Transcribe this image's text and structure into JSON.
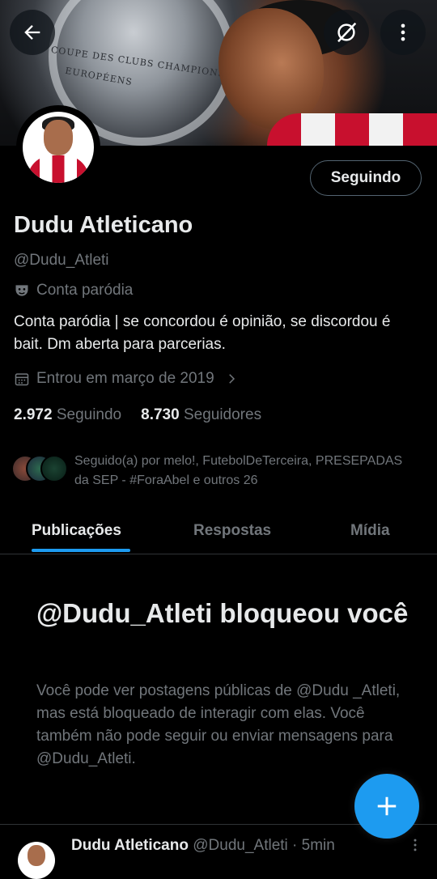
{
  "header": {
    "back_icon": "arrow-left-icon",
    "grok_icon": "grok-icon",
    "more_icon": "more-vertical-icon",
    "banner_text_line1": "COUPE DES CLUBS CHAMPIONS",
    "banner_text_line2": "EUROPÉENS"
  },
  "profile": {
    "follow_button_label": "Seguindo",
    "display_name": "Dudu Atleticano",
    "handle": "@Dudu_Atleti",
    "parody_label": "Conta paródia",
    "bio": "Conta paródia | se concordou é opinião, se discordou é bait. Dm aberta para parcerias.",
    "joined": "Entrou em março de 2019",
    "following_count": "2.972",
    "following_label": "Seguindo",
    "followers_count": "8.730",
    "followers_label": "Seguidores",
    "followed_by": "Seguido(a) por melo!, FutebolDeTerceira, PRESEPADAS da SEP - #ForaAbel e outros 26"
  },
  "tabs": [
    {
      "label": "Publicações",
      "active": true
    },
    {
      "label": "Respostas",
      "active": false
    },
    {
      "label": "Mídia",
      "active": false
    }
  ],
  "blocked": {
    "title": "@Dudu_Atleti bloqueou você",
    "description": "Você pode ver postagens públicas de @Dudu _Atleti, mas está bloqueado de interagir com elas. Você também não pode seguir ou enviar mensagens para @Dudu_Atleti."
  },
  "post": {
    "author": "Dudu Atleticano",
    "handle_time": "@Dudu_Atleti · 5min"
  },
  "colors": {
    "accent": "#1d9bf0",
    "text_primary": "#e7e9ea",
    "text_secondary": "#71767b",
    "background": "#000000"
  }
}
